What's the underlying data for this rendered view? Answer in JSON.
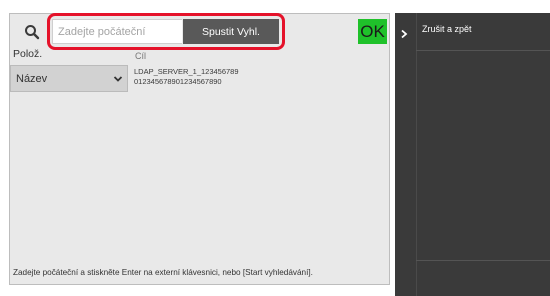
{
  "search": {
    "placeholder": "Zadejte počáteční",
    "start_label": "Spustit Vyhl."
  },
  "ok_label": "OK",
  "fields": {
    "item_label": "Polož.",
    "column_label": "Cíl",
    "select_value": "Název"
  },
  "server": {
    "line1": "LDAP_SERVER_1_123456789",
    "line2": "012345678901234567890"
  },
  "hint": "Zadejte počáteční a stiskněte Enter na externí klávesnici, nebo [Start vyhledávání].",
  "right_panel": {
    "title": "Zrušit a zpět"
  },
  "colors": {
    "highlight": "#e5122a",
    "ok_button": "#1fc12a",
    "search_button": "#595959",
    "panel_dark": "#3a3a3a"
  },
  "icons": {
    "search": "search-icon",
    "chevron": "chevron-down-icon",
    "arrow": "chevron-right-icon"
  }
}
